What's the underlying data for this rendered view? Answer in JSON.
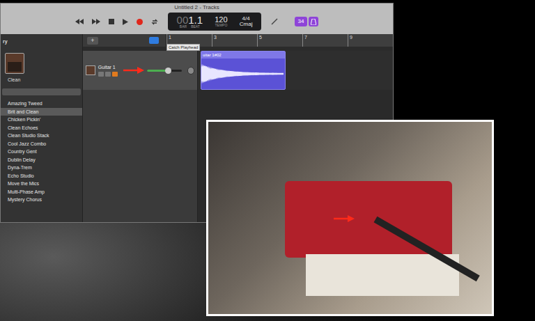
{
  "window": {
    "title": "Untitled 2 - Tracks"
  },
  "lcd": {
    "bar_beat": "1.1",
    "bar_prefix": "00",
    "bar_label": "BAR",
    "beat_label": "BEAT",
    "tempo": "120",
    "tempo_label": "TEMPO",
    "signature": "4/4",
    "key": "Cmaj"
  },
  "badges": [
    "34"
  ],
  "tooltip": "Catch Playhead",
  "add_button": "+",
  "ruler": [
    "1",
    "3",
    "5",
    "7",
    "9"
  ],
  "library": {
    "header": "ry",
    "amp_name": "Clean",
    "search": {
      "placeholder": ""
    },
    "patches": [
      {
        "label": "Amazing Tweed",
        "selected": false
      },
      {
        "label": "Brit and Clean",
        "selected": true
      },
      {
        "label": "Chicken Pickin'",
        "selected": false
      },
      {
        "label": "Clean Echoes",
        "selected": false
      },
      {
        "label": "Clean Studio Stack",
        "selected": false
      },
      {
        "label": "Cool Jazz Combo",
        "selected": false
      },
      {
        "label": "Country Gent",
        "selected": false
      },
      {
        "label": "Dublin Delay",
        "selected": false
      },
      {
        "label": "Dyna-Trem",
        "selected": false
      },
      {
        "label": "Echo Studio",
        "selected": false
      },
      {
        "label": "Move the Mics",
        "selected": false
      },
      {
        "label": "Multi-Phase Amp",
        "selected": false
      },
      {
        "label": "Mystery Chorus",
        "selected": false
      }
    ]
  },
  "track": {
    "name": "Guitar 1",
    "volume": {
      "level": 0.6
    },
    "muted": false,
    "solo": false,
    "record_enabled": true,
    "region": {
      "label": "uitar 1#02"
    }
  },
  "photo": {
    "description": "audio interface with cable"
  }
}
